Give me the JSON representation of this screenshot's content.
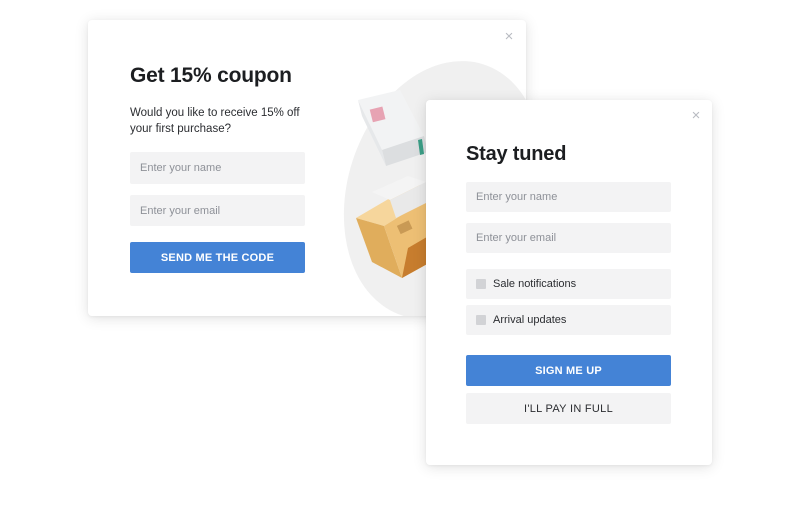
{
  "coupon_popup": {
    "close_icon": "×",
    "title": "Get 15% coupon",
    "subtitle_line1": "Would you like to receive 15% off",
    "subtitle_line2": "your first purchase?",
    "name_placeholder": "Enter your name",
    "email_placeholder": "Enter your email",
    "submit_label": "SEND ME THE CODE",
    "illustration": "package-boxes-illustration"
  },
  "stay_tuned_popup": {
    "close_icon": "×",
    "title": "Stay tuned",
    "name_placeholder": "Enter your name",
    "email_placeholder": "Enter your email",
    "checkboxes": [
      {
        "label": "Sale notifications",
        "checked": false
      },
      {
        "label": "Arrival updates",
        "checked": false
      }
    ],
    "primary_label": "SIGN ME UP",
    "secondary_label": "I'LL PAY IN FULL"
  },
  "colors": {
    "accent": "#4483d6",
    "field_bg": "#f3f3f4",
    "title_text": "#1c1e21"
  }
}
